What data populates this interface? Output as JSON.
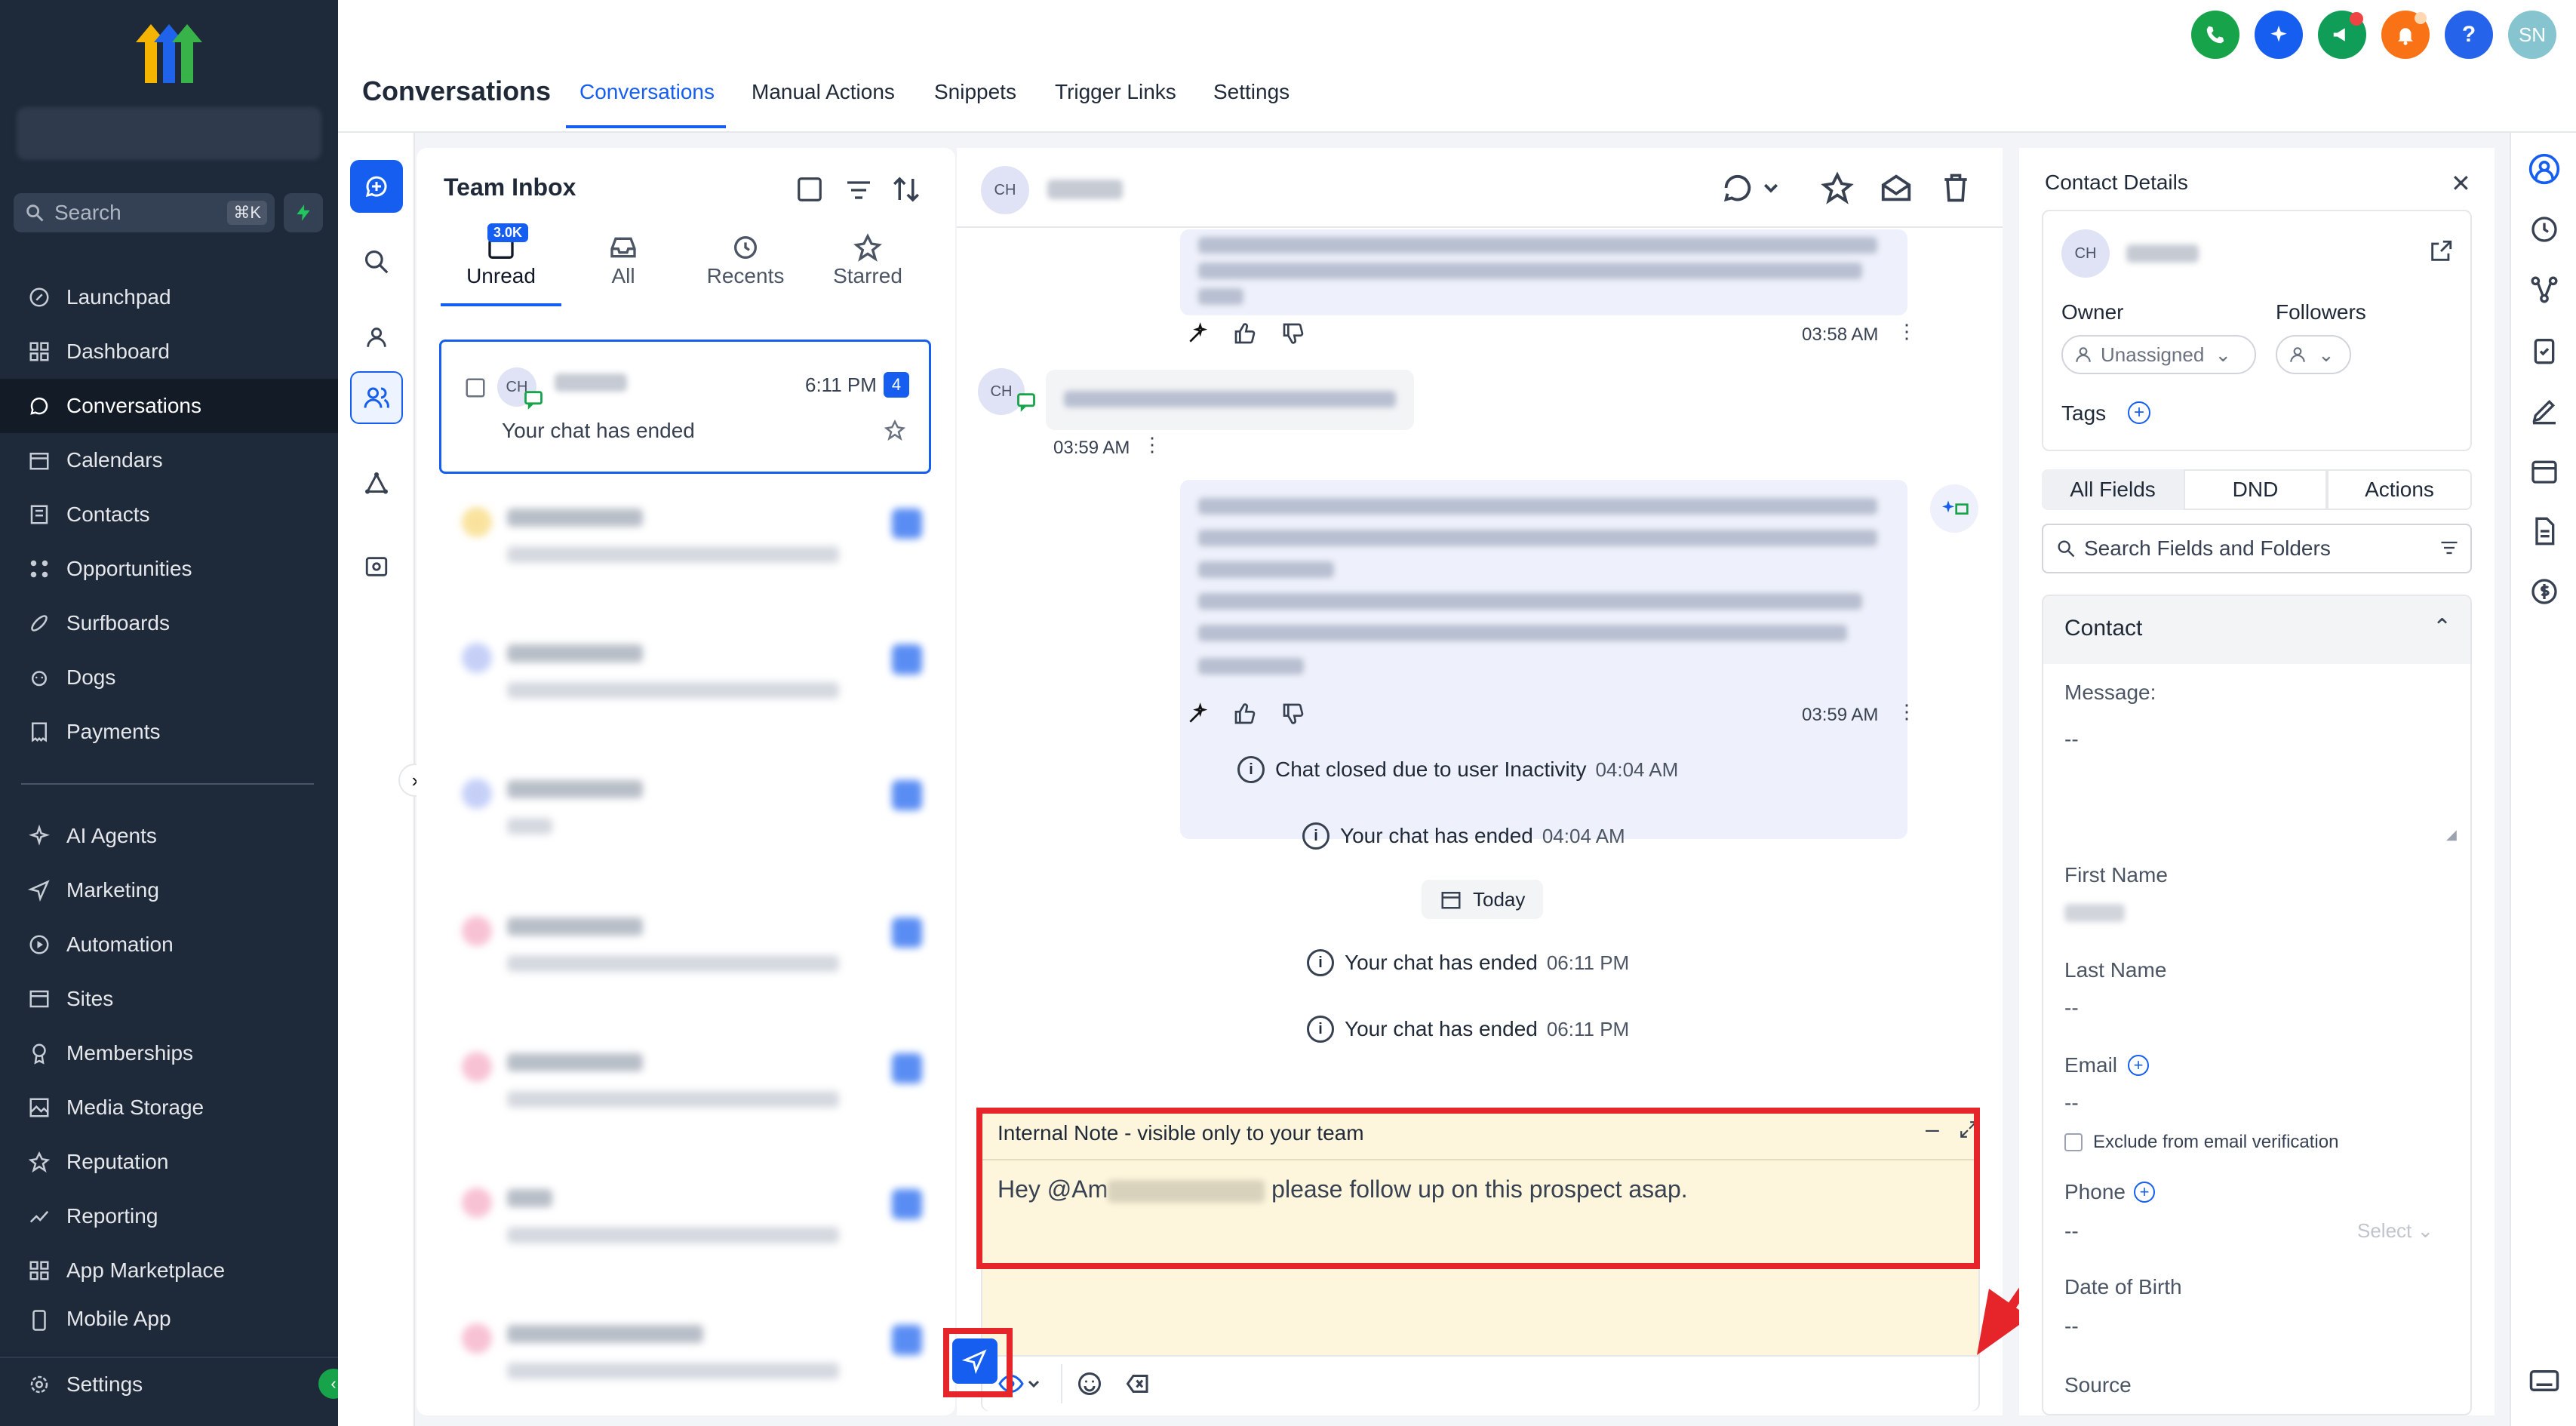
{
  "sidebar": {
    "search_placeholder": "Search",
    "search_shortcut": "⌘K",
    "items": [
      {
        "label": "Launchpad",
        "icon": "rocket-icon"
      },
      {
        "label": "Dashboard",
        "icon": "grid-icon"
      },
      {
        "label": "Conversations",
        "icon": "chat-icon"
      },
      {
        "label": "Calendars",
        "icon": "calendar-icon"
      },
      {
        "label": "Contacts",
        "icon": "contacts-icon"
      },
      {
        "label": "Opportunities",
        "icon": "opportunities-icon"
      },
      {
        "label": "Surfboards",
        "icon": "surfboard-icon"
      },
      {
        "label": "Dogs",
        "icon": "dog-icon"
      },
      {
        "label": "Payments",
        "icon": "receipt-icon"
      }
    ],
    "items2": [
      {
        "label": "AI Agents",
        "icon": "sparkle-icon"
      },
      {
        "label": "Marketing",
        "icon": "send-icon"
      },
      {
        "label": "Automation",
        "icon": "automation-icon"
      },
      {
        "label": "Sites",
        "icon": "sites-icon"
      },
      {
        "label": "Memberships",
        "icon": "memberships-icon"
      },
      {
        "label": "Media Storage",
        "icon": "image-icon"
      },
      {
        "label": "Reputation",
        "icon": "star-icon"
      },
      {
        "label": "Reporting",
        "icon": "trend-icon"
      },
      {
        "label": "App Marketplace",
        "icon": "apps-icon"
      },
      {
        "label": "Mobile App",
        "icon": "mobile-icon"
      }
    ],
    "settings_label": "Settings"
  },
  "header": {
    "page_title": "Conversations",
    "tabs": [
      "Conversations",
      "Manual Actions",
      "Snippets",
      "Trigger Links",
      "Settings"
    ],
    "user_initials": "SN",
    "colors": {
      "phone": "#16a34a",
      "ai": "#155eef",
      "announce": "#0f9d58",
      "bell": "#f97316",
      "help": "#2563eb",
      "avatar": "#86c5cf"
    }
  },
  "list": {
    "title": "Team Inbox",
    "tabs": [
      {
        "label": "Unread",
        "badge": "3.0K"
      },
      {
        "label": "All"
      },
      {
        "label": "Recents"
      },
      {
        "label": "Starred"
      }
    ],
    "active_conversation": {
      "avatar": "CH",
      "time": "6:11 PM",
      "count": "4",
      "preview": "Your chat has ended"
    }
  },
  "chat": {
    "avatar": "CH",
    "messages": [
      {
        "time": "03:58 AM"
      },
      {
        "time": "03:59 AM",
        "avatar": "CH"
      },
      {
        "time": "03:59 AM"
      }
    ],
    "events": [
      {
        "text": "Chat closed due to user Inactivity",
        "time": "04:04 AM"
      },
      {
        "text": "Your chat has ended",
        "time": "04:04 AM"
      },
      {
        "text": "Your chat has ended",
        "time": "06:11 PM"
      },
      {
        "text": "Your chat has ended",
        "time": "06:11 PM"
      }
    ],
    "divider": "Today",
    "note": {
      "header": "Internal Note - visible only to your team",
      "text_before": "Hey @Am",
      "text_after": " please follow up on this prospect asap."
    }
  },
  "contact": {
    "title": "Contact Details",
    "avatar": "CH",
    "owner_label": "Owner",
    "owner_value": "Unassigned",
    "followers_label": "Followers",
    "tags_label": "Tags",
    "segments": [
      "All Fields",
      "DND",
      "Actions"
    ],
    "search_placeholder": "Search Fields and Folders",
    "section": "Contact",
    "fields": {
      "message_label": "Message:",
      "message_value": "--",
      "first_name_label": "First Name",
      "last_name_label": "Last Name",
      "last_name_value": "--",
      "email_label": "Email",
      "email_value": "--",
      "exclude_label": "Exclude from email verification",
      "phone_label": "Phone",
      "phone_value": "--",
      "phone_select": "Select",
      "dob_label": "Date of Birth",
      "dob_value": "--",
      "source_label": "Source"
    }
  }
}
